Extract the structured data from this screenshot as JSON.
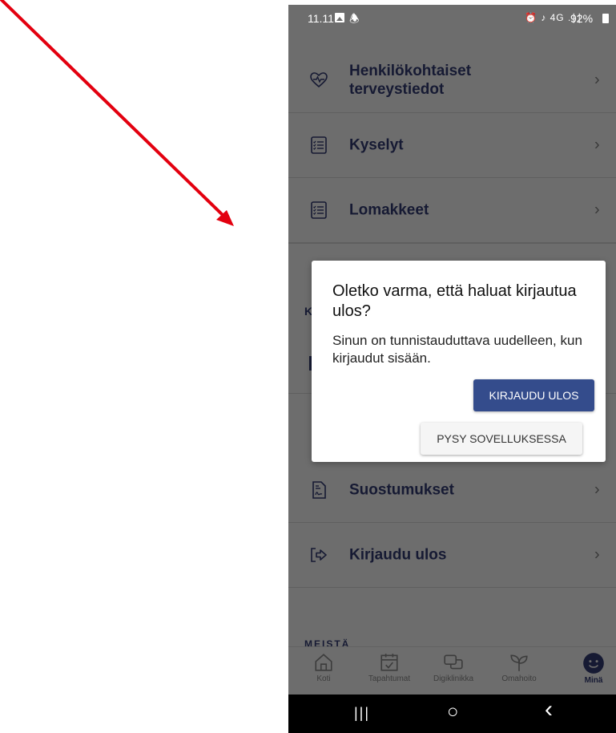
{
  "status_bar": {
    "time": "11.11",
    "network_icons": "⏰ ♪ 4G .∣∣",
    "battery": "92%"
  },
  "menu": {
    "items": [
      {
        "label": "Henkilökohtaiset terveystiedot",
        "icon": "heart-pulse-icon"
      },
      {
        "label": "Kyselyt",
        "icon": "checklist-icon"
      },
      {
        "label": "Lomakkeet",
        "icon": "checklist-icon"
      },
      {
        "label": "Suostumukset",
        "icon": "signed-document-icon"
      },
      {
        "label": "Kirjaudu ulos",
        "icon": "logout-icon"
      }
    ],
    "chevron": "›",
    "section_peek": "K",
    "section_bottom": "MEISTÄ"
  },
  "dialog": {
    "title": "Oletko varma, että haluat kirjautua ulos?",
    "message": "Sinun on tunnistauduttava uudelleen, kun kirjaudut sisään.",
    "confirm_label": "KIRJAUDU ULOS",
    "cancel_label": "PYSY SOVELLUKSESSA"
  },
  "bottom_nav": {
    "items": [
      {
        "label": "Koti",
        "icon": "home-icon"
      },
      {
        "label": "Tapahtumat",
        "icon": "calendar-check-icon"
      },
      {
        "label": "Digiklinikka",
        "icon": "chat-bubbles-icon"
      },
      {
        "label": "Omahoito",
        "icon": "sprout-icon"
      },
      {
        "label": "Minä",
        "icon": "smiley-icon",
        "active": true
      }
    ]
  },
  "system_nav": {
    "recents": "|||",
    "home": "○",
    "back": "‹"
  },
  "colors": {
    "overlay": "#6d6d6d",
    "primary": "#344c8c",
    "annotation_arrow": "#e3000f",
    "text_dark": "#161a33"
  }
}
